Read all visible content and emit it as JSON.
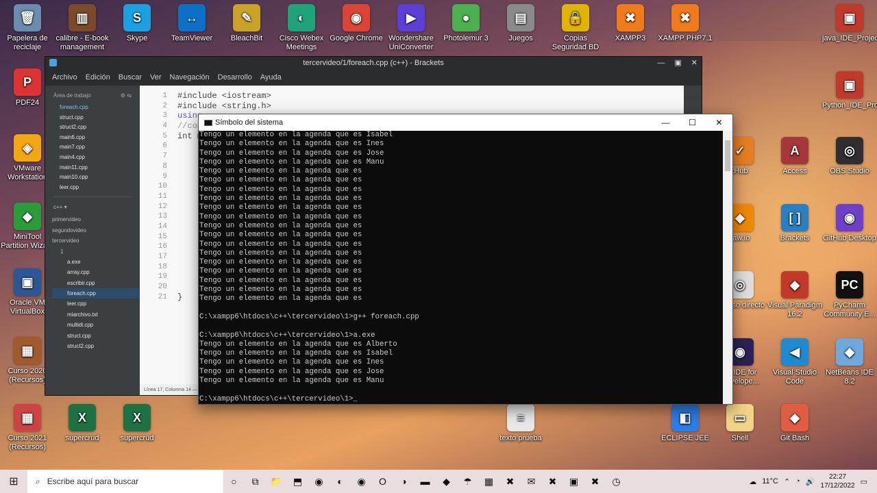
{
  "desktop": {
    "icons_top": [
      {
        "label": "Papelera de reciclaje",
        "glyph": "🗑",
        "color": "#6b8cae"
      },
      {
        "label": "calibre - E-book management",
        "glyph": "▥",
        "color": "#7a4a2a"
      },
      {
        "label": "Skype",
        "glyph": "S",
        "color": "#1ba1e2"
      },
      {
        "label": "TeamViewer",
        "glyph": "↔",
        "color": "#0e6fc7"
      },
      {
        "label": "BleachBit",
        "glyph": "✎",
        "color": "#c9a227"
      },
      {
        "label": "Cisco Webex Meetings",
        "glyph": "◐",
        "color": "#1fa37a"
      },
      {
        "label": "Google Chrome",
        "glyph": "◉",
        "color": "#db4437"
      },
      {
        "label": "Wondershare UniConverter",
        "glyph": "▶",
        "color": "#5b3fd6"
      },
      {
        "label": "Photolemur 3",
        "glyph": "●",
        "color": "#4caf50"
      },
      {
        "label": "Juegos",
        "glyph": "▤",
        "color": "#8a8a8a"
      },
      {
        "label": "Copias Seguridad BD",
        "glyph": "🔒",
        "color": "#e0b400"
      },
      {
        "label": "XAMPP3",
        "glyph": "✖",
        "color": "#f07a1c"
      },
      {
        "label": "XAMPP PHP7.1",
        "glyph": "✖",
        "color": "#f07a1c"
      }
    ],
    "icons_left": [
      {
        "label": "PDF24",
        "glyph": "P",
        "color": "#d33"
      },
      {
        "label": "VMware Workstation",
        "glyph": "◈",
        "color": "#f3a712"
      },
      {
        "label": "MiniTool Partition Wizard",
        "glyph": "◆",
        "color": "#2a9d3a"
      },
      {
        "label": "Oracle VM VirtualBox",
        "glyph": "▣",
        "color": "#2b5797"
      },
      {
        "label": "Curso 2020 (Recursos)",
        "glyph": "▦",
        "color": "#a05a2c"
      },
      {
        "label": "Curso 2021 (Recursos)",
        "glyph": "▦",
        "color": "#c44"
      }
    ],
    "icons_bottom": [
      {
        "label": "supercrud",
        "glyph": "X",
        "color": "#1e7145"
      },
      {
        "label": "supercrud",
        "glyph": "X",
        "color": "#1e7145"
      },
      {
        "label": "texto prueba",
        "glyph": "≡",
        "color": "#e8e8e8"
      },
      {
        "label": "ECLIPSE JEE",
        "glyph": "◧",
        "color": "#2b7de9"
      },
      {
        "label": "Shell",
        "glyph": "▭",
        "color": "#f2d488"
      },
      {
        "label": "Git Bash",
        "glyph": "◆",
        "color": "#e05d44"
      }
    ],
    "icons_right": [
      {
        "label": "java_IDE_Projects",
        "glyph": "▣",
        "color": "#c0392b"
      },
      {
        "label": "Python_IDE_Pro...",
        "glyph": "▣",
        "color": "#c0392b"
      },
      {
        "label": "Access",
        "glyph": "A",
        "color": "#a4373a"
      },
      {
        "label": "OBS Studio",
        "glyph": "◎",
        "color": "#302e31"
      },
      {
        "label": "Brackets",
        "glyph": "[ ]",
        "color": "#2a7fc1"
      },
      {
        "label": "GitHub Desktop",
        "glyph": "◉",
        "color": "#6e40c9"
      },
      {
        "label": "Visual Paradigm 16.2",
        "glyph": "◆",
        "color": "#c0392b"
      },
      {
        "label": "PyCharm Community E...",
        "glyph": "PC",
        "color": "#111"
      },
      {
        "label": "Visual Studio Code",
        "glyph": "◀",
        "color": "#1f8ad2"
      },
      {
        "label": "NetBeans IDE 8.2",
        "glyph": "◆",
        "color": "#6fa8dc"
      }
    ],
    "icons_partial": [
      {
        "label": "tHub",
        "glyph": "✓",
        "color": "#e67e22"
      },
      {
        "label": "raw.io",
        "glyph": "◆",
        "color": "#f08705"
      },
      {
        "label": "Acceso directo",
        "glyph": "◎",
        "color": "#ddd"
      },
      {
        "label": "se IDE for Develope...",
        "glyph": "◉",
        "color": "#2c2255"
      }
    ]
  },
  "brackets": {
    "title": "tercervideo/1/foreach.cpp (c++) - Brackets",
    "menu": [
      "Archivo",
      "Edición",
      "Buscar",
      "Ver",
      "Navegación",
      "Desarrollo",
      "Ayuda"
    ],
    "working_area": "Área de trabajo",
    "working_files": [
      "foreach.cpp",
      "struct.cpp",
      "struct2.cpp",
      "main6.cpp",
      "main7.cpp",
      "main4.cpp",
      "main11.cpp",
      "main10.cpp",
      "leer.cpp"
    ],
    "project_label": "c++ ▾",
    "tree": {
      "folders": [
        "primervideo",
        "segundovideo",
        "tercervideo"
      ],
      "subfolder": "1",
      "files": [
        "a.exe",
        "array.cpp",
        "escribir.cpp",
        "foreach.cpp",
        "leer.cpp",
        "miarchivo.txt",
        "multidi.cpp",
        "struct.cpp",
        "struct2.cpp"
      ]
    },
    "line_numbers": [
      "1",
      "2",
      "3",
      "4",
      "5",
      "6",
      "7",
      "8",
      "9",
      "10",
      "11",
      "12",
      "13",
      "14",
      "15",
      "16",
      "17",
      "18",
      "19",
      "20",
      "21"
    ],
    "code_lines": [
      "#include <iostream>",
      "#include <string.h>",
      "using",
      "//con",
      "int m",
      "",
      "",
      "",
      "",
      "",
      "",
      "",
      "",
      "",
      "",
      "",
      "",
      "",
      "",
      "",
      "}"
    ],
    "status": "Línea 17, Columna 14 — 21"
  },
  "cmd": {
    "title": "Símbolo del sistema",
    "lines": [
      "Tengo un elemento en la agenda que es Isabel",
      "Tengo un elemento en la agenda que es Ines",
      "Tengo un elemento en la agenda que es Jose",
      "Tengo un elemento en la agenda que es Manu",
      "Tengo un elemento en la agenda que es",
      "Tengo un elemento en la agenda que es",
      "Tengo un elemento en la agenda que es",
      "Tengo un elemento en la agenda que es",
      "Tengo un elemento en la agenda que es",
      "Tengo un elemento en la agenda que es",
      "Tengo un elemento en la agenda que es",
      "Tengo un elemento en la agenda que es",
      "Tengo un elemento en la agenda que es",
      "Tengo un elemento en la agenda que es",
      "Tengo un elemento en la agenda que es",
      "Tengo un elemento en la agenda que es",
      "Tengo un elemento en la agenda que es",
      "Tengo un elemento en la agenda que es",
      "Tengo un elemento en la agenda que es",
      "",
      "C:\\xampp6\\htdocs\\c++\\tercervideo\\1>g++ foreach.cpp",
      "",
      "C:\\xampp6\\htdocs\\c++\\tercervideo\\1>a.exe",
      "Tengo un elemento en la agenda que es Alberto",
      "Tengo un elemento en la agenda que es Isabel",
      "Tengo un elemento en la agenda que es Ines",
      "Tengo un elemento en la agenda que es Jose",
      "Tengo un elemento en la agenda que es Manu",
      "",
      "C:\\xampp6\\htdocs\\c++\\tercervideo\\1>_"
    ]
  },
  "taskbar": {
    "search_placeholder": "Escribe aquí para buscar",
    "weather": "11°C",
    "time": "22:27",
    "date": "17/12/2022",
    "apps": [
      "📁",
      "⬒",
      "◉",
      "◐",
      "◉",
      "O",
      "◑",
      "▬",
      "◆",
      "☂",
      "▦",
      "✖",
      "✉",
      "✖",
      "▣",
      "✖",
      "◷"
    ]
  }
}
